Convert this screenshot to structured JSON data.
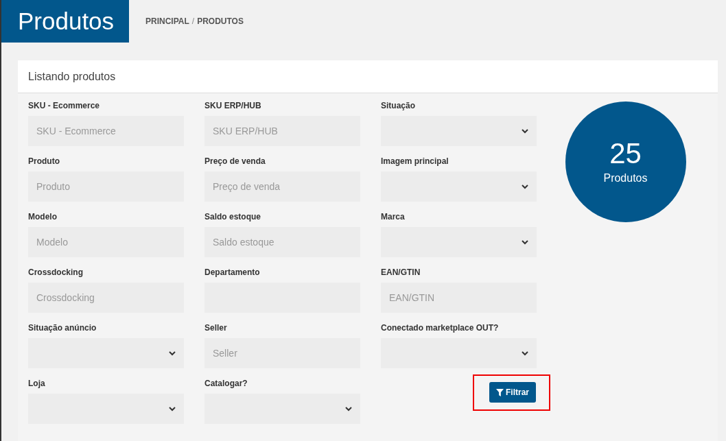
{
  "header": {
    "title": "Produtos",
    "breadcrumb": [
      {
        "label": "PRINCIPAL"
      },
      {
        "label": "PRODUTOS"
      }
    ],
    "separator": "/"
  },
  "card": {
    "title": "Listando produtos",
    "columns": [
      [
        {
          "label": "SKU - Ecommerce",
          "kind": "input",
          "placeholder": "SKU - Ecommerce"
        },
        {
          "label": "Produto",
          "kind": "input",
          "placeholder": "Produto"
        },
        {
          "label": "Modelo",
          "kind": "input",
          "placeholder": "Modelo"
        },
        {
          "label": "Crossdocking",
          "kind": "input",
          "placeholder": "Crossdocking"
        },
        {
          "label": "Situação anúncio",
          "kind": "select"
        },
        {
          "label": "Loja",
          "kind": "select"
        }
      ],
      [
        {
          "label": "SKU ERP/HUB",
          "kind": "input",
          "placeholder": "SKU ERP/HUB"
        },
        {
          "label": "Preço de venda",
          "kind": "input",
          "placeholder": "Preço de venda"
        },
        {
          "label": "Saldo estoque",
          "kind": "input",
          "placeholder": "Saldo estoque"
        },
        {
          "label": "Departamento",
          "kind": "input"
        },
        {
          "label": "Seller",
          "kind": "input",
          "placeholder": "Seller"
        },
        {
          "label": "Catalogar?",
          "kind": "select"
        }
      ],
      [
        {
          "label": "Situação",
          "kind": "select"
        },
        {
          "label": "Imagem principal",
          "kind": "select"
        },
        {
          "label": "Marca",
          "kind": "select"
        },
        {
          "label": "EAN/GTIN",
          "kind": "input",
          "placeholder": "EAN/GTIN"
        },
        {
          "label": "Conectado marketplace OUT?",
          "kind": "select"
        }
      ]
    ],
    "filter_button": {
      "label": "Filtrar",
      "highlighted": true
    },
    "counter": {
      "value": "25",
      "label": "Produtos"
    }
  }
}
